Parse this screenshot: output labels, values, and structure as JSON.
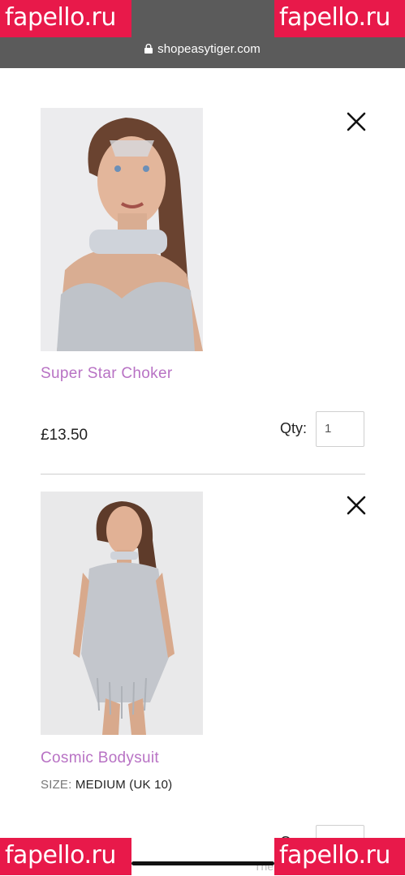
{
  "browser": {
    "url": "shopeasytiger.com"
  },
  "watermark": {
    "text": "fapello.ru"
  },
  "items": [
    {
      "name": "Super Star Choker",
      "price": "£13.50",
      "qty_label": "Qty:",
      "qty_value": "1"
    },
    {
      "name": "Cosmic Bodysuit",
      "size_label": "SIZE:",
      "size_value": "MEDIUM (UK 10)",
      "qty_label": "Q"
    }
  ],
  "footer_peek": "The",
  "colors": {
    "accent": "#b872c4",
    "topbar": "#5b5b5b",
    "watermark": "#e8194a"
  }
}
